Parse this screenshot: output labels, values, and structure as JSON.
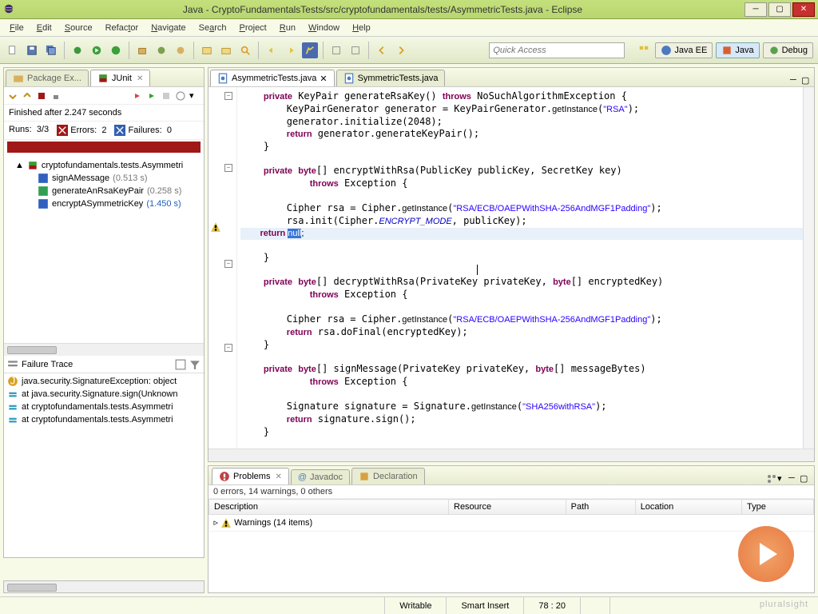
{
  "window": {
    "title": "Java - CryptoFundamentalsTests/src/cryptofundamentals/tests/AsymmetricTests.java - Eclipse"
  },
  "menu": [
    "File",
    "Edit",
    "Source",
    "Refactor",
    "Navigate",
    "Search",
    "Project",
    "Run",
    "Window",
    "Help"
  ],
  "quick_access_placeholder": "Quick Access",
  "perspectives": {
    "javaee": "Java EE",
    "java": "Java",
    "debug": "Debug"
  },
  "left": {
    "tabs": {
      "package": "Package Ex...",
      "junit": "JUnit"
    },
    "finished": "Finished after 2.247 seconds",
    "runs_label": "Runs:",
    "runs_value": "3/3",
    "errors_label": "Errors:",
    "errors_value": "2",
    "failures_label": "Failures:",
    "failures_value": "0",
    "tree": {
      "root": "cryptofundamentals.tests.Asymmetri",
      "items": [
        {
          "name": "signAMessage",
          "time": "(0.513 s)",
          "cls": "ms"
        },
        {
          "name": "generateAnRsaKeyPair",
          "time": "(0.258 s)",
          "cls": "ms"
        },
        {
          "name": "encryptASymmetricKey",
          "time": "(1.450 s)",
          "cls": "ms blue"
        }
      ]
    },
    "failure_trace_title": "Failure Trace",
    "trace": [
      "java.security.SignatureException: object",
      "at java.security.Signature.sign(Unknown",
      "at cryptofundamentals.tests.Asymmetri",
      "at cryptofundamentals.tests.Asymmetri"
    ]
  },
  "editor": {
    "tabs": {
      "active": "AsymmetricTests.java",
      "inactive": "SymmetricTests.java"
    }
  },
  "problems": {
    "tabs": {
      "problems": "Problems",
      "javadoc": "Javadoc",
      "declaration": "Declaration"
    },
    "summary": "0 errors, 14 warnings, 0 others",
    "columns": [
      "Description",
      "Resource",
      "Path",
      "Location",
      "Type"
    ],
    "row1": "Warnings (14 items)"
  },
  "statusbar": {
    "writable": "Writable",
    "insert": "Smart Insert",
    "pos": "78 : 20"
  },
  "watermark": "pluralsight",
  "chart_data": {
    "type": "table",
    "title": "JUnit run results",
    "series": [
      {
        "name": "Runs",
        "values": [
          "3/3"
        ]
      },
      {
        "name": "Errors",
        "values": [
          2
        ]
      },
      {
        "name": "Failures",
        "values": [
          0
        ]
      }
    ],
    "tests": [
      {
        "name": "signAMessage",
        "seconds": 0.513,
        "status": "error"
      },
      {
        "name": "generateAnRsaKeyPair",
        "seconds": 0.258,
        "status": "pass"
      },
      {
        "name": "encryptASymmetricKey",
        "seconds": 1.45,
        "status": "error"
      }
    ],
    "total_seconds": 2.247
  }
}
